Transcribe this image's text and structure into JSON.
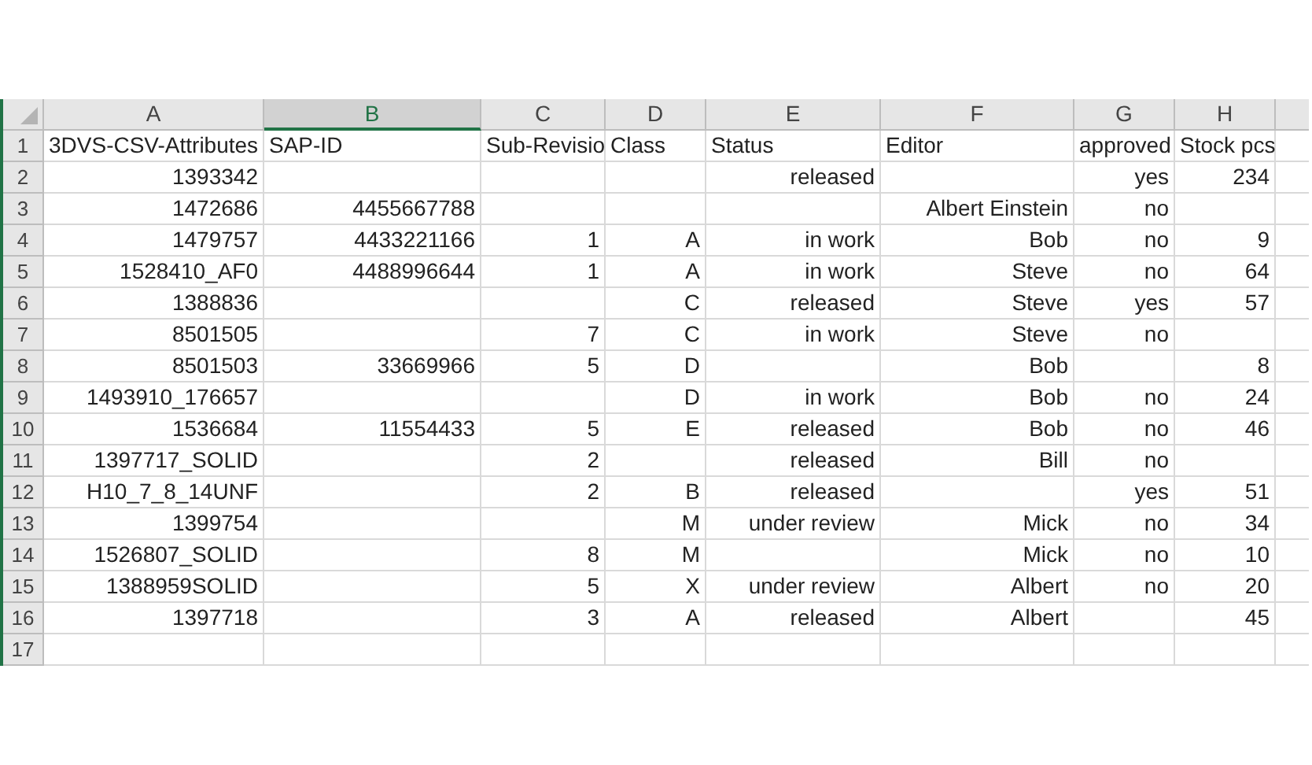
{
  "columns": [
    {
      "label": "A",
      "selected": false
    },
    {
      "label": "B",
      "selected": true
    },
    {
      "label": "C",
      "selected": false
    },
    {
      "label": "D",
      "selected": false
    },
    {
      "label": "E",
      "selected": false
    },
    {
      "label": "F",
      "selected": false
    },
    {
      "label": "G",
      "selected": false
    },
    {
      "label": "H",
      "selected": false
    }
  ],
  "rows": [
    {
      "number": "1",
      "kind": "header",
      "cells": {
        "A": "3DVS-CSV-Attributes",
        "B": "SAP-ID",
        "C": "Sub-Revisio",
        "D": "Class",
        "E": "Status",
        "F": "Editor",
        "G": "approved",
        "H": "Stock pcs"
      }
    },
    {
      "number": "2",
      "kind": "data",
      "cells": {
        "A": "1393342",
        "E": "released",
        "G": "yes",
        "H": "234"
      }
    },
    {
      "number": "3",
      "kind": "data",
      "cells": {
        "A": "1472686",
        "B": "4455667788",
        "F": "Albert Einstein",
        "G": "no"
      }
    },
    {
      "number": "4",
      "kind": "data",
      "cells": {
        "A": "1479757",
        "B": "4433221166",
        "C": "1",
        "D": "A",
        "E": "in work",
        "F": "Bob",
        "G": "no",
        "H": "9"
      }
    },
    {
      "number": "5",
      "kind": "data",
      "cells": {
        "A": "1528410_AF0",
        "B": "4488996644",
        "C": "1",
        "D": "A",
        "E": "in work",
        "F": "Steve",
        "G": "no",
        "H": "64"
      }
    },
    {
      "number": "6",
      "kind": "data",
      "cells": {
        "A": "1388836",
        "D": "C",
        "E": "released",
        "F": "Steve",
        "G": "yes",
        "H": "57"
      }
    },
    {
      "number": "7",
      "kind": "data",
      "cells": {
        "A": "8501505",
        "C": "7",
        "D": "C",
        "E": "in work",
        "F": "Steve",
        "G": "no"
      }
    },
    {
      "number": "8",
      "kind": "data",
      "cells": {
        "A": "8501503",
        "B": "33669966",
        "C": "5",
        "D": "D",
        "F": "Bob",
        "H": "8"
      }
    },
    {
      "number": "9",
      "kind": "data",
      "cells": {
        "A": "1493910_176657",
        "D": "D",
        "E": "in work",
        "F": "Bob",
        "G": "no",
        "H": "24"
      }
    },
    {
      "number": "10",
      "kind": "data",
      "cells": {
        "A": "1536684",
        "B": "11554433",
        "C": "5",
        "D": "E",
        "E": "released",
        "F": "Bob",
        "G": "no",
        "H": "46"
      }
    },
    {
      "number": "11",
      "kind": "data",
      "cells": {
        "A": "1397717_SOLID",
        "C": "2",
        "E": "released",
        "F": "Bill",
        "G": "no"
      }
    },
    {
      "number": "12",
      "kind": "data",
      "cells": {
        "A": "H10_7_8_14UNF",
        "C": "2",
        "D": "B",
        "E": "released",
        "G": "yes",
        "H": "51"
      }
    },
    {
      "number": "13",
      "kind": "data",
      "cells": {
        "A": "1399754",
        "D": "M",
        "E": "under review",
        "F": "Mick",
        "G": "no",
        "H": "34"
      }
    },
    {
      "number": "14",
      "kind": "data",
      "cells": {
        "A": "1526807_SOLID",
        "C": "8",
        "D": "M",
        "F": "Mick",
        "G": "no",
        "H": "10"
      }
    },
    {
      "number": "15",
      "kind": "data",
      "cells": {
        "A": "1388959SOLID",
        "C": "5",
        "D": "X",
        "E": "under review",
        "F": "Albert",
        "G": "no",
        "H": "20"
      }
    },
    {
      "number": "16",
      "kind": "data",
      "cells": {
        "A": "1397718",
        "C": "3",
        "D": "A",
        "E": "released",
        "F": "Albert",
        "H": "45"
      }
    },
    {
      "number": "17",
      "kind": "data",
      "cells": {}
    }
  ]
}
